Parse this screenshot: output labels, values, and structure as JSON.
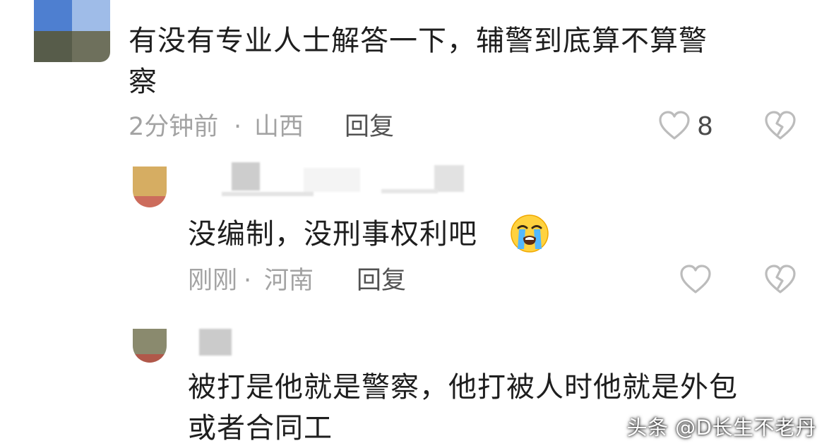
{
  "comment": {
    "text_line1": "有没有专业人士解答一下，辅警到底算不算警",
    "text_line2": "察",
    "time": "2分钟前",
    "separator": "·",
    "location": "山西",
    "reply_label": "回复",
    "like_count": "8"
  },
  "replies": [
    {
      "text": "没编制，没刑事权利吧",
      "emoji": "loudly-crying-face",
      "time": "刚刚",
      "separator": "·",
      "location": "河南",
      "reply_label": "回复"
    },
    {
      "text_line1": "被打是他就是警察，他打被人时他就是外包",
      "text_line2": "或者合同工"
    }
  ],
  "watermark": "头条 @D长生不老丹",
  "icons": {
    "like": "heart-outline-icon",
    "dislike": "broken-heart-icon"
  },
  "colors": {
    "text": "#1e1e1e",
    "meta": "#a3a3a3",
    "reply": "#525252",
    "icon": "#bcbcbc"
  }
}
